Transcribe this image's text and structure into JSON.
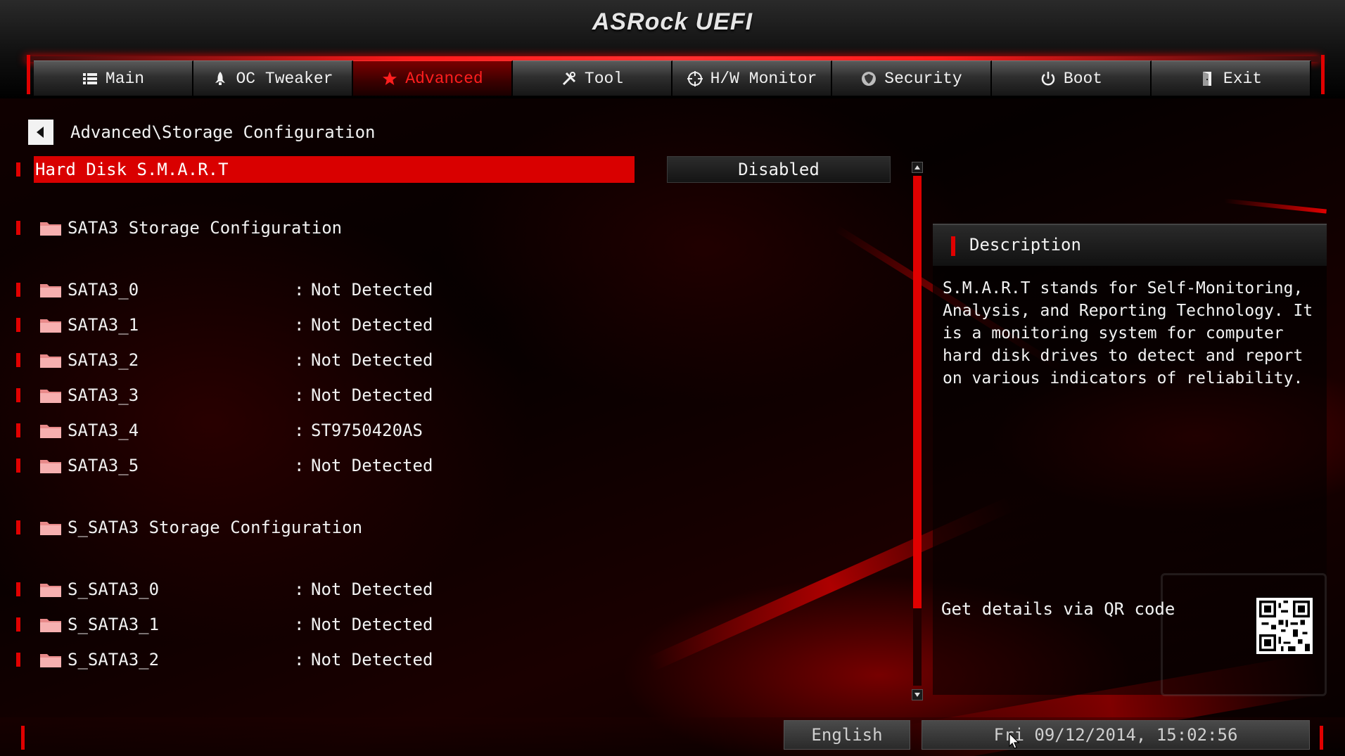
{
  "header": {
    "logo": "ASRock UEFI",
    "tabs": [
      {
        "label": "Main",
        "icon": "list-icon",
        "active": false
      },
      {
        "label": "OC Tweaker",
        "icon": "rocket-icon",
        "active": false
      },
      {
        "label": "Advanced",
        "icon": "star-icon",
        "active": true
      },
      {
        "label": "Tool",
        "icon": "tools-icon",
        "active": false
      },
      {
        "label": "H/W Monitor",
        "icon": "crosshair-icon",
        "active": false
      },
      {
        "label": "Security",
        "icon": "shield-icon",
        "active": false
      },
      {
        "label": "Boot",
        "icon": "power-icon",
        "active": false
      },
      {
        "label": "Exit",
        "icon": "exit-door-icon",
        "active": false
      }
    ]
  },
  "breadcrumb": "Advanced\\Storage Configuration",
  "selected_option": {
    "label": "Hard Disk S.M.A.R.T",
    "value": "Disabled"
  },
  "sections": [
    {
      "title": "SATA3 Storage Configuration",
      "ports": [
        {
          "name": "SATA3_0",
          "value": "Not Detected"
        },
        {
          "name": "SATA3_1",
          "value": "Not Detected"
        },
        {
          "name": "SATA3_2",
          "value": "Not Detected"
        },
        {
          "name": "SATA3_3",
          "value": "Not Detected"
        },
        {
          "name": "SATA3_4",
          "value": "ST9750420AS"
        },
        {
          "name": "SATA3_5",
          "value": "Not Detected"
        }
      ]
    },
    {
      "title": "S_SATA3 Storage Configuration",
      "ports": [
        {
          "name": "S_SATA3_0",
          "value": "Not Detected"
        },
        {
          "name": "S_SATA3_1",
          "value": "Not Detected"
        },
        {
          "name": "S_SATA3_2",
          "value": "Not Detected"
        }
      ]
    }
  ],
  "colon": ":",
  "description": {
    "title": "Description",
    "text": "S.M.A.R.T stands for Self-Monitoring, Analysis, and Reporting Technology. It is a monitoring system for computer hard disk drives to detect and report on various indicators of reliability.",
    "qr_label": "Get details via QR code"
  },
  "footer": {
    "language": "English",
    "datetime": "Fri 09/12/2014, 15:02:56"
  },
  "colors": {
    "accent": "#e00000",
    "highlight": "#d90000",
    "text": "#f2f2f2"
  }
}
